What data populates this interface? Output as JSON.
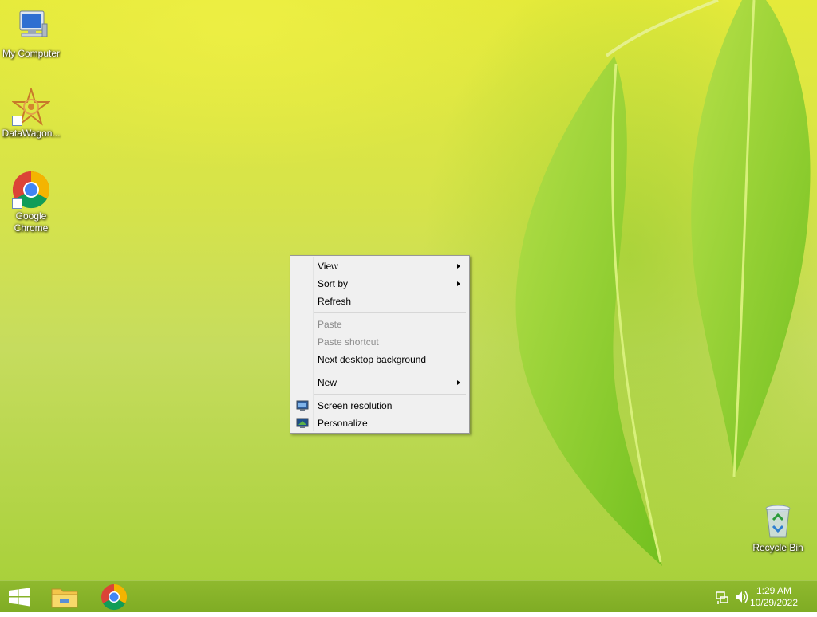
{
  "desktop": {
    "icons": [
      {
        "label": "My Computer",
        "icon": "computer-icon"
      },
      {
        "label": "DataWagon...",
        "icon": "datawagon-icon"
      },
      {
        "label": "Google Chrome",
        "icon": "chrome-icon"
      },
      {
        "label": "Recycle Bin",
        "icon": "recycle-bin-icon"
      }
    ]
  },
  "context_menu": {
    "items": [
      {
        "label": "View",
        "submenu": true,
        "enabled": true
      },
      {
        "label": "Sort by",
        "submenu": true,
        "enabled": true
      },
      {
        "label": "Refresh",
        "submenu": false,
        "enabled": true
      },
      {
        "label": "Paste",
        "submenu": false,
        "enabled": false
      },
      {
        "label": "Paste shortcut",
        "submenu": false,
        "enabled": false
      },
      {
        "label": "Next desktop background",
        "submenu": false,
        "enabled": true
      },
      {
        "label": "New",
        "submenu": true,
        "enabled": true
      },
      {
        "label": "Screen resolution",
        "submenu": false,
        "enabled": true,
        "icon": "screen-resolution-icon"
      },
      {
        "label": "Personalize",
        "submenu": false,
        "enabled": true,
        "icon": "personalize-icon"
      }
    ]
  },
  "taskbar": {
    "start_icon": "windows-logo-icon",
    "pinned": [
      "file-explorer-icon",
      "chrome-icon"
    ],
    "tray_icons": [
      "network-icon",
      "volume-icon"
    ],
    "clock": {
      "time": "1:29 AM",
      "date": "10/29/2022"
    }
  },
  "colors": {
    "taskbar": "#84b026",
    "menu_background": "#f0f0f0",
    "menu_border": "#979797",
    "disabled_text": "#8c8c8c"
  }
}
